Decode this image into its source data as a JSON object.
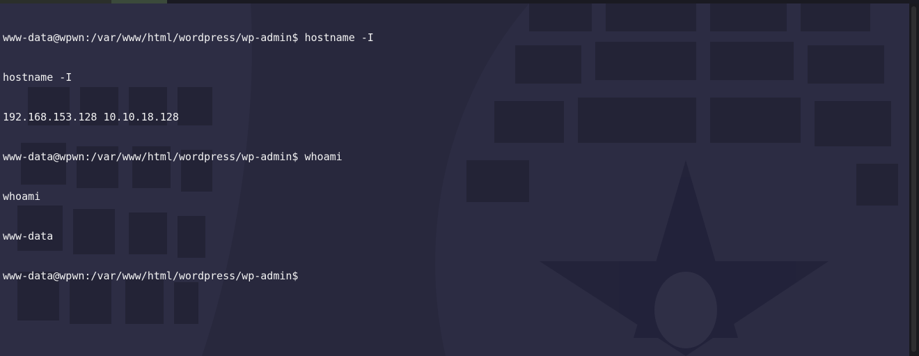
{
  "terminal": {
    "lines": [
      "www-data@wpwn:/var/www/html/wordpress/wp-admin$ hostname -I",
      "hostname -I",
      "192.168.153.128 10.10.18.128",
      "www-data@wpwn:/var/www/html/wordpress/wp-admin$ whoami",
      "whoami",
      "www-data",
      "www-data@wpwn:/var/www/html/wordpress/wp-admin$"
    ]
  },
  "colors": {
    "background": "#28283d",
    "foreground": "#f2f2f2",
    "scrollbar": "#1a1a1e"
  }
}
